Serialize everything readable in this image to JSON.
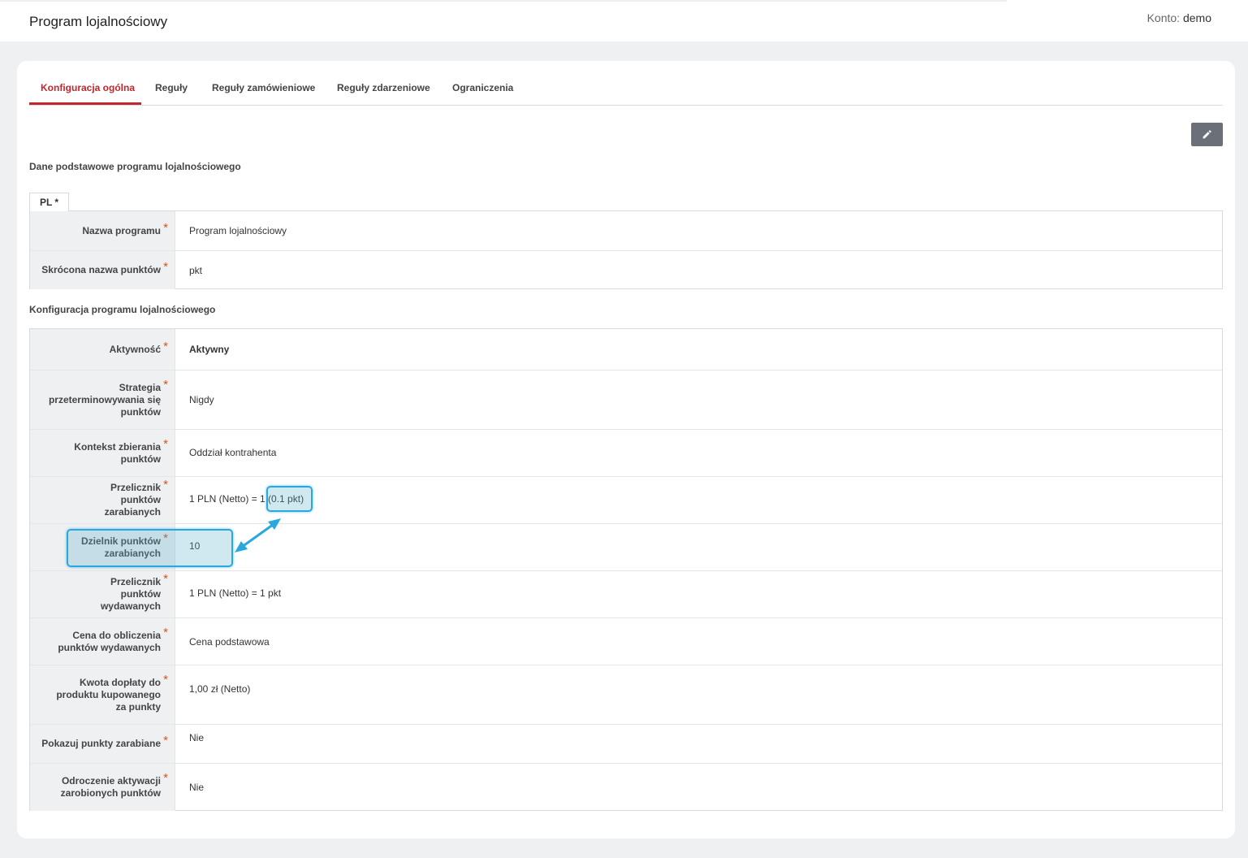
{
  "header": {
    "title": "Program lojalnościowy",
    "account_label": "Konto:",
    "account_name": "demo"
  },
  "tabs": [
    {
      "label": "Konfiguracja ogólna",
      "active": true
    },
    {
      "label": "Reguły",
      "active": false
    },
    {
      "label": "Reguły zamówieniowe",
      "active": false
    },
    {
      "label": "Reguły zdarzeniowe",
      "active": false
    },
    {
      "label": "Ograniczenia",
      "active": false
    }
  ],
  "toolbar": {
    "edit_icon": "pencil-icon"
  },
  "basic_section": {
    "title": "Dane podstawowe programu lojalnościowego",
    "lang_tab": "PL *",
    "rows": [
      {
        "label": "Nazwa programu",
        "value": "Program lojalnościowy"
      },
      {
        "label": "Skrócona nazwa punktów",
        "value": "pkt"
      }
    ]
  },
  "config_section": {
    "title": "Konfiguracja programu lojalnościowego",
    "rows": [
      {
        "label": "Aktywność",
        "value": "Aktywny"
      },
      {
        "label": "Strategia przeterminowywania się punktów",
        "value": "Nigdy"
      },
      {
        "label": "Kontekst zbierania punktów",
        "value": "Oddział kontrahenta"
      },
      {
        "label": "Przelicznik punktów zarabianych",
        "value_prefix": "1 PLN (Netto) = 1 ",
        "value_highlight": "(0.1 pkt)"
      },
      {
        "label": "Dzielnik punktów zarabianych",
        "value": "10"
      },
      {
        "label": "Przelicznik punktów wydawanych",
        "value": "1 PLN (Netto) = 1 pkt"
      },
      {
        "label": "Cena do obliczenia punktów wydawanych",
        "value": "Cena podstawowa"
      },
      {
        "label": "Kwota dopłaty do produktu kupowanego za punkty",
        "value": "1,00 zł (Netto)"
      },
      {
        "label": "Pokazuj punkty zarabiane",
        "value": "Nie"
      },
      {
        "label": "Odroczenie aktywacji zarobionych punktów",
        "value": "Nie"
      }
    ]
  },
  "required_mark": "*",
  "colors": {
    "accent": "#c0282d",
    "required": "#d9531e",
    "highlight": "#29a8dd",
    "edit_button": "#6b6f78"
  }
}
